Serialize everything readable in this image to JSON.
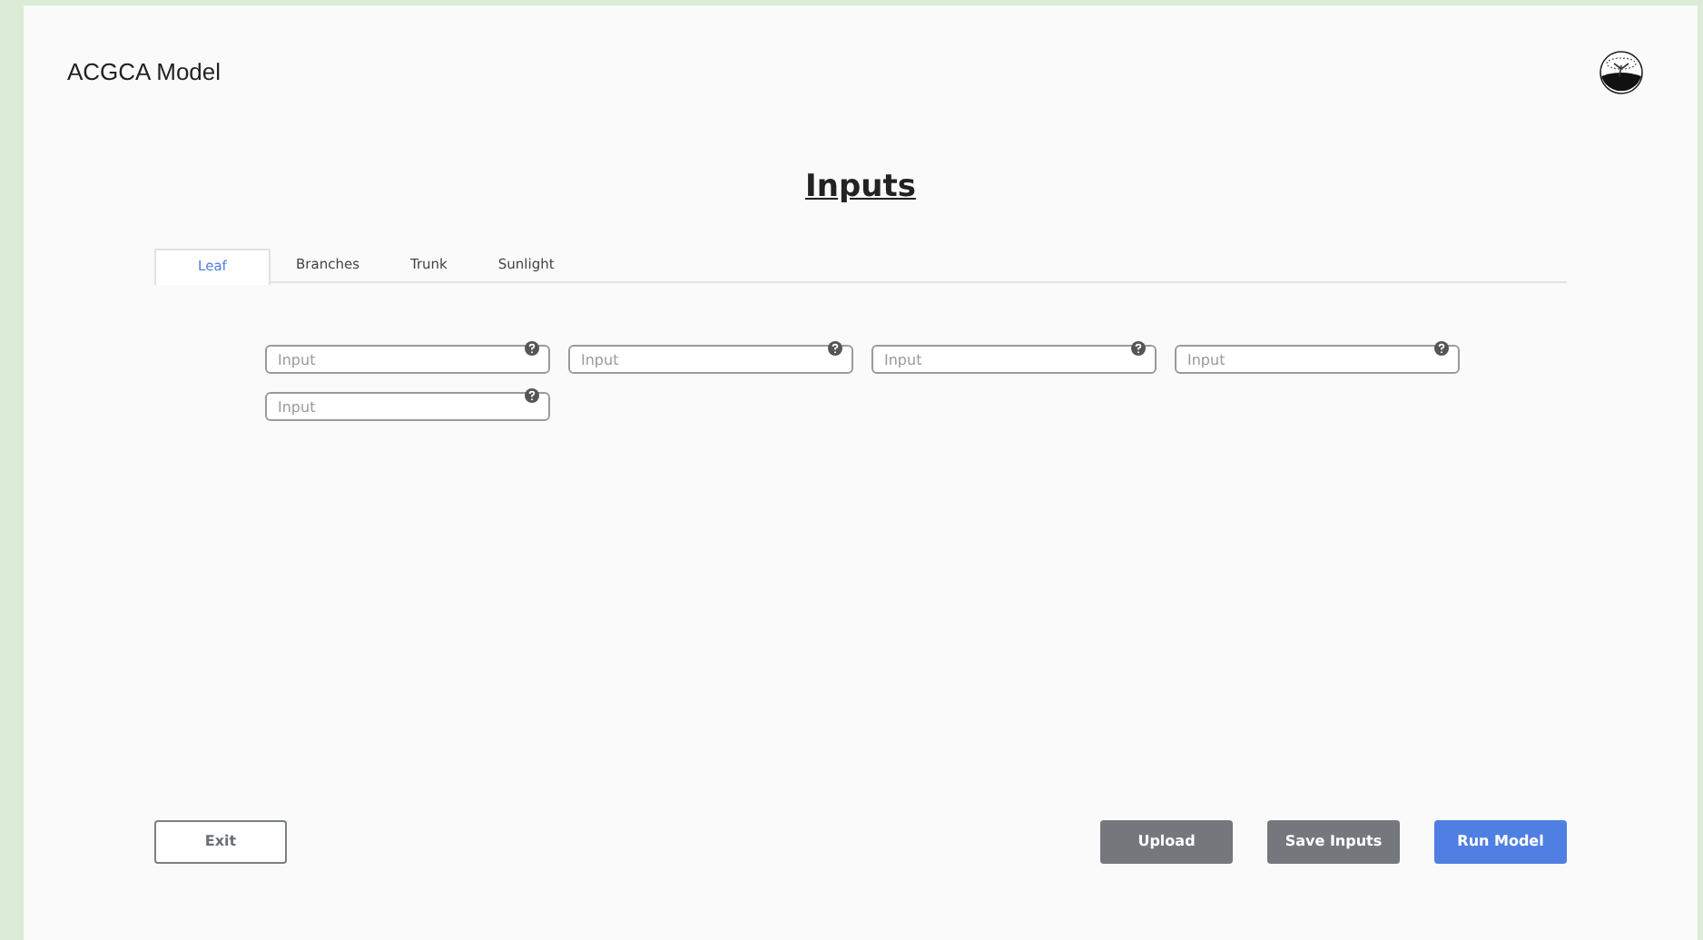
{
  "app_title": "ACGCA Model",
  "heading": "Inputs",
  "tabs": [
    {
      "label": "Leaf",
      "selected": true
    },
    {
      "label": "Branches",
      "selected": false
    },
    {
      "label": "Trunk",
      "selected": false
    },
    {
      "label": "Sunlight",
      "selected": false
    }
  ],
  "fields": [
    {
      "placeholder": "Input"
    },
    {
      "placeholder": "Input"
    },
    {
      "placeholder": "Input"
    },
    {
      "placeholder": "Input"
    },
    {
      "placeholder": "Input"
    }
  ],
  "buttons_left": [
    {
      "label": "Exit",
      "kind": "outline"
    }
  ],
  "buttons_right": [
    {
      "label": "Upload",
      "kind": "secondary"
    },
    {
      "label": "Save Inputs",
      "kind": "secondary"
    },
    {
      "label": "Run Model",
      "kind": "primary"
    }
  ]
}
